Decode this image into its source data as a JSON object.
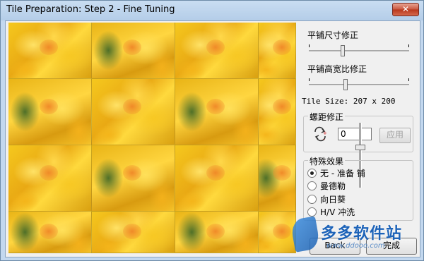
{
  "window": {
    "title": "Tile Preparation: Step 2 - Fine Tuning",
    "close_label": "✕"
  },
  "sliders": {
    "size_correction": {
      "label": "平铺尺寸修正",
      "value": 0.33
    },
    "aspect_correction": {
      "label": "平铺高宽比修正",
      "value": 0.36
    }
  },
  "tile_size_text": "Tile Size: 207 x 200",
  "spacing": {
    "title": "螺距修正",
    "value": "0",
    "apply_label": "应用",
    "icon": "rotate-spin-icon"
  },
  "effects": {
    "title": "特殊效果",
    "options": [
      {
        "label": "无 - 准备 铺",
        "checked": true
      },
      {
        "label": "曼德勒",
        "checked": false
      },
      {
        "label": "向日葵",
        "checked": false
      },
      {
        "label": "H/V 冲洗",
        "checked": false
      }
    ]
  },
  "buttons": {
    "back": "Back",
    "finish": "完成"
  },
  "watermark": {
    "text": "多多软件站",
    "sub": "www.ddooo.com"
  }
}
